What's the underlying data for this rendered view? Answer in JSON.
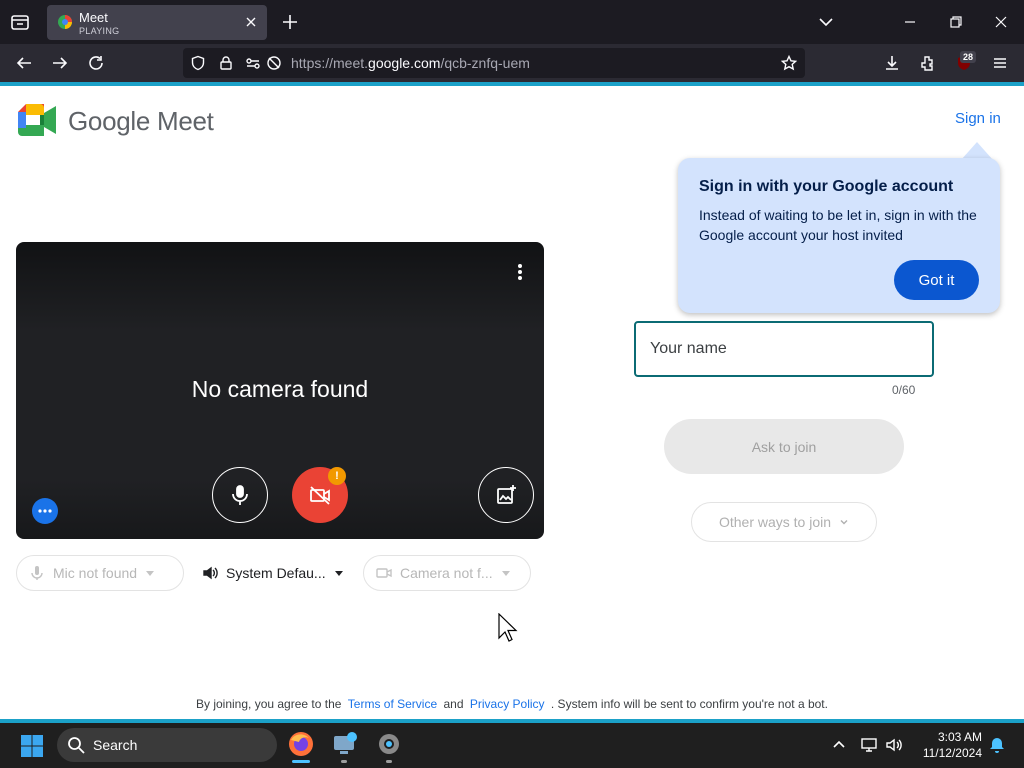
{
  "browser": {
    "tab": {
      "title": "Meet",
      "status": "PLAYING"
    },
    "url": {
      "prefix": "https://meet.",
      "domain": "google.com",
      "path": "/qcb-znfq-uem"
    },
    "extension_badge": "28",
    "colors": {
      "accent": "#1ba1c8",
      "frame": "#1c1b22"
    }
  },
  "page": {
    "brand": "Google Meet",
    "signin_link": "Sign in",
    "tooltip": {
      "title": "Sign in with your Google account",
      "body": "Instead of waiting to be let in, sign in with the Google account your host invited",
      "button": "Got it"
    },
    "preview": {
      "message": "No camera found",
      "warning_badge": "!"
    },
    "devices": {
      "mic": "Mic not found",
      "speaker": "System Defau...",
      "camera": "Camera not f..."
    },
    "join": {
      "name_placeholder": "Your name",
      "char_count": "0/60",
      "ask_button": "Ask to join",
      "other_ways": "Other ways to join"
    },
    "footer": {
      "prefix": "By joining, you agree to the",
      "terms": "Terms of Service",
      "and": "and",
      "privacy": "Privacy Policy",
      "suffix": ". System info will be sent to confirm you're not a bot."
    }
  },
  "taskbar": {
    "search": "Search",
    "time": "3:03 AM",
    "date": "11/12/2024"
  }
}
